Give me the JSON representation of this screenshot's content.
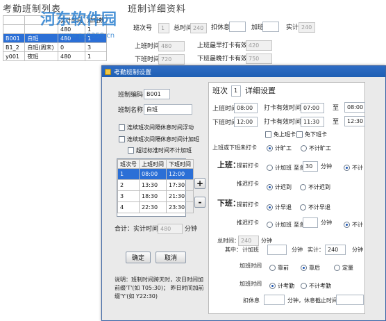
{
  "bg": {
    "list_title": "考勤班制列表",
    "detail_title": "班制详细资料",
    "watermark": "河东软件园",
    "watermark_url": "www.pc0359.cn",
    "list_header": [
      "",
      "",
      "实计时间",
      "加班数"
    ],
    "list_rows": [
      [
        "",
        "",
        "480",
        "1"
      ],
      [
        "B001",
        "白班",
        "480",
        "1"
      ],
      [
        "B1_2",
        "白班(周末)",
        "0",
        "3"
      ],
      [
        "y001",
        "夜班",
        "480",
        "1"
      ]
    ],
    "labels": {
      "shift_no": "班次号",
      "shift_no_val": "1",
      "total": "总时间",
      "total_val": "240",
      "deduct": "扣休息",
      "overtime": "加班",
      "actual": "实计",
      "actual_val": "240",
      "on_time": "上班时间",
      "on_time_val": "480",
      "on_earliest": "上班最早打卡有效时间",
      "on_earliest_val": "420",
      "off_time": "下班时间",
      "off_time_val": "720",
      "off_latest": "下班最晚打卡有效时间",
      "off_latest_val": "750"
    }
  },
  "dialog": {
    "title": "考勤班制设置",
    "code_label": "班制编码",
    "code_value": "B001",
    "name_label": "班制名称",
    "name_value": "白班",
    "check1": "连续班次间隔休息时间浮动",
    "check2": "连续班次间隔休息时间计加班",
    "check3": "超过标准时间不计加班",
    "grid_headers": [
      "班次号",
      "上班时间",
      "下班时间"
    ],
    "grid_rows": [
      [
        "1",
        "08:00",
        "12:00"
      ],
      [
        "2",
        "13:30",
        "17:30"
      ],
      [
        "3",
        "18:30",
        "21:30"
      ],
      [
        "4",
        "22:30",
        "23:30"
      ]
    ],
    "add_btn": "+",
    "remove_btn": "-",
    "total_label": "合计：实计时间",
    "total_value": "480",
    "total_unit": "分钟",
    "ok_btn": "确定",
    "cancel_btn": "取消",
    "note": "说明：班制时间跨天时，次日时间加前缀'T'(如  T05:30)；  昨日时间加前缀'Y'(如  Y22:30)",
    "detail": {
      "shift_label": "班次",
      "shift_value": "1",
      "detail_label": "详细设置",
      "on_label": "上班时间",
      "on_value": "08:00",
      "on_valid_label": "打卡有效时间",
      "on_valid_from": "07:00",
      "to1": "至",
      "on_valid_to": "08:00",
      "off_label": "下班时间",
      "off_value": "12:00",
      "off_valid_label": "打卡有效时间",
      "off_valid_from": "11:30",
      "to2": "至",
      "off_valid_to": "12:30",
      "free_on": "免上班卡",
      "free_off": "免下班卡",
      "count_label": "上班或下班未打卡",
      "count_absent": "计旷工",
      "count_not": "不计旷工",
      "on_heading": "上班：",
      "remind_on": "提前打卡",
      "calc_ot": "计加班",
      "at_least": "至多",
      "on_at_least_val": "30",
      "minutes": "分钟",
      "not_count": "不计",
      "delay_on": "推迟打卡",
      "calc_late": "计迟到",
      "not_late": "不计迟到",
      "off_heading": "下班：",
      "remind_off": "提前打卡",
      "calc_early": "计早退",
      "not_early": "不计早退",
      "delay_off": "推迟打卡",
      "calc_ot2": "计加班",
      "at_most": "至多",
      "not_count2": "不计",
      "total_time_label": "总时间：",
      "total_time_value": "240",
      "total_time_unit": "分钟",
      "in_label": "其中：",
      "ot_label": "计加班",
      "ot_unit": "分钟",
      "actual_label": "实计：",
      "actual_value": "240",
      "actual_unit": "分钟",
      "ot_time_label": "加班时间",
      "before": "靠前",
      "after": "靠后",
      "fixed": "定量",
      "ot_time_label2": "加班时间",
      "calc_attend": "计考勤",
      "not_attend": "不计考勤",
      "rest_label": "扣休息",
      "rest_unit": "分钟，休息截止时间"
    }
  },
  "colors": {
    "dialog_title_bg": "#1f5fb4",
    "selected_row": "#2b6fd6",
    "dialog_body": "#eaeaea"
  }
}
